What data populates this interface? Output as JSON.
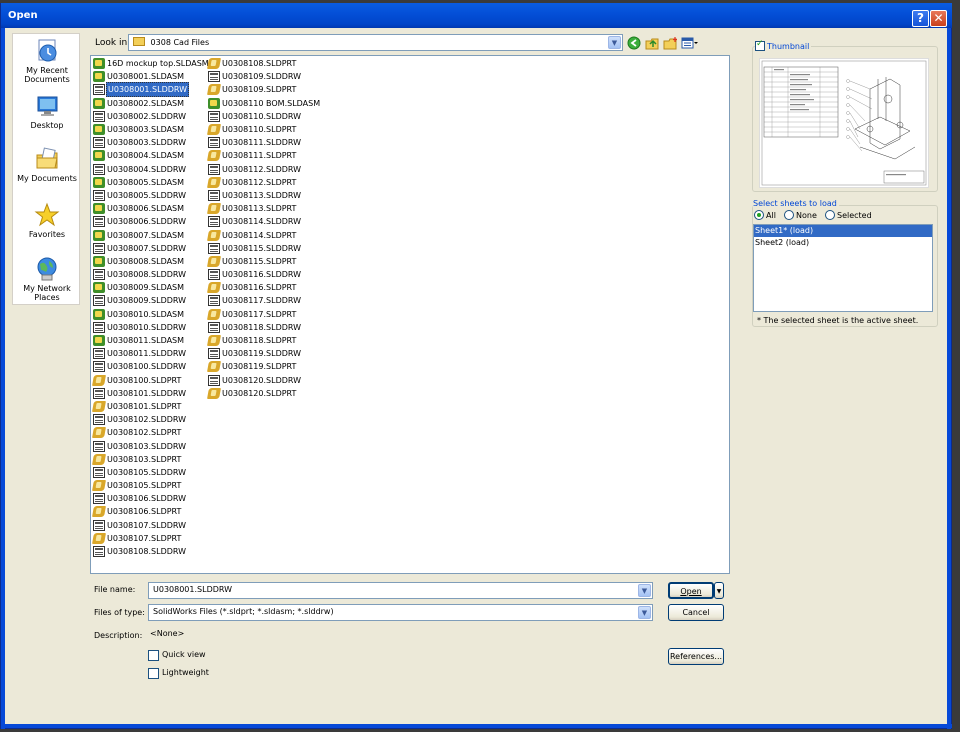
{
  "dialog": {
    "title": "Open",
    "help": "?",
    "close": "✕"
  },
  "places": [
    {
      "label": "My Recent Documents",
      "icon": "recent-documents-icon"
    },
    {
      "label": "Desktop",
      "icon": "desktop-icon"
    },
    {
      "label": "My Documents",
      "icon": "my-documents-icon"
    },
    {
      "label": "Favorites",
      "icon": "favorites-icon"
    },
    {
      "label": "My Network Places",
      "icon": "network-places-icon"
    }
  ],
  "lookin": {
    "label": "Look in:",
    "value": "0308 Cad Files"
  },
  "files_col1": [
    {
      "name": "16D mockup top.SLDASM",
      "t": "asm"
    },
    {
      "name": "U0308001.SLDASM",
      "t": "asm"
    },
    {
      "name": "U0308001.SLDDRW",
      "t": "drw",
      "sel": true
    },
    {
      "name": "U0308002.SLDASM",
      "t": "asm"
    },
    {
      "name": "U0308002.SLDDRW",
      "t": "drw"
    },
    {
      "name": "U0308003.SLDASM",
      "t": "asm"
    },
    {
      "name": "U0308003.SLDDRW",
      "t": "drw"
    },
    {
      "name": "U0308004.SLDASM",
      "t": "asm"
    },
    {
      "name": "U0308004.SLDDRW",
      "t": "drw"
    },
    {
      "name": "U0308005.SLDASM",
      "t": "asm"
    },
    {
      "name": "U0308005.SLDDRW",
      "t": "drw"
    },
    {
      "name": "U0308006.SLDASM",
      "t": "asm"
    },
    {
      "name": "U0308006.SLDDRW",
      "t": "drw"
    },
    {
      "name": "U0308007.SLDASM",
      "t": "asm"
    },
    {
      "name": "U0308007.SLDDRW",
      "t": "drw"
    },
    {
      "name": "U0308008.SLDASM",
      "t": "asm"
    },
    {
      "name": "U0308008.SLDDRW",
      "t": "drw"
    },
    {
      "name": "U0308009.SLDASM",
      "t": "asm"
    },
    {
      "name": "U0308009.SLDDRW",
      "t": "drw"
    },
    {
      "name": "U0308010.SLDASM",
      "t": "asm"
    },
    {
      "name": "U0308010.SLDDRW",
      "t": "drw"
    },
    {
      "name": "U0308011.SLDASM",
      "t": "asm"
    },
    {
      "name": "U0308011.SLDDRW",
      "t": "drw"
    },
    {
      "name": "U0308100.SLDDRW",
      "t": "drw"
    },
    {
      "name": "U0308100.SLDPRT",
      "t": "prt"
    },
    {
      "name": "U0308101.SLDDRW",
      "t": "drw"
    },
    {
      "name": "U0308101.SLDPRT",
      "t": "prt"
    },
    {
      "name": "U0308102.SLDDRW",
      "t": "drw"
    },
    {
      "name": "U0308102.SLDPRT",
      "t": "prt"
    },
    {
      "name": "U0308103.SLDDRW",
      "t": "drw"
    },
    {
      "name": "U0308103.SLDPRT",
      "t": "prt"
    },
    {
      "name": "U0308105.SLDDRW",
      "t": "drw"
    },
    {
      "name": "U0308105.SLDPRT",
      "t": "prt"
    },
    {
      "name": "U0308106.SLDDRW",
      "t": "drw"
    },
    {
      "name": "U0308106.SLDPRT",
      "t": "prt"
    },
    {
      "name": "U0308107.SLDDRW",
      "t": "drw"
    },
    {
      "name": "U0308107.SLDPRT",
      "t": "prt"
    },
    {
      "name": "U0308108.SLDDRW",
      "t": "drw"
    }
  ],
  "files_col2": [
    {
      "name": "U0308108.SLDPRT",
      "t": "prt"
    },
    {
      "name": "U0308109.SLDDRW",
      "t": "drw"
    },
    {
      "name": "U0308109.SLDPRT",
      "t": "prt"
    },
    {
      "name": "U0308110 BOM.SLDASM",
      "t": "asm"
    },
    {
      "name": "U0308110.SLDDRW",
      "t": "drw"
    },
    {
      "name": "U0308110.SLDPRT",
      "t": "prt"
    },
    {
      "name": "U0308111.SLDDRW",
      "t": "drw"
    },
    {
      "name": "U0308111.SLDPRT",
      "t": "prt"
    },
    {
      "name": "U0308112.SLDDRW",
      "t": "drw"
    },
    {
      "name": "U0308112.SLDPRT",
      "t": "prt"
    },
    {
      "name": "U0308113.SLDDRW",
      "t": "drw"
    },
    {
      "name": "U0308113.SLDPRT",
      "t": "prt"
    },
    {
      "name": "U0308114.SLDDRW",
      "t": "drw"
    },
    {
      "name": "U0308114.SLDPRT",
      "t": "prt"
    },
    {
      "name": "U0308115.SLDDRW",
      "t": "drw"
    },
    {
      "name": "U0308115.SLDPRT",
      "t": "prt"
    },
    {
      "name": "U0308116.SLDDRW",
      "t": "drw"
    },
    {
      "name": "U0308116.SLDPRT",
      "t": "prt"
    },
    {
      "name": "U0308117.SLDDRW",
      "t": "drw"
    },
    {
      "name": "U0308117.SLDPRT",
      "t": "prt"
    },
    {
      "name": "U0308118.SLDDRW",
      "t": "drw"
    },
    {
      "name": "U0308118.SLDPRT",
      "t": "prt"
    },
    {
      "name": "U0308119.SLDDRW",
      "t": "drw"
    },
    {
      "name": "U0308119.SLDPRT",
      "t": "prt"
    },
    {
      "name": "U0308120.SLDDRW",
      "t": "drw"
    },
    {
      "name": "U0308120.SLDPRT",
      "t": "prt"
    }
  ],
  "filename": {
    "label": "File name:",
    "value": "U0308001.SLDDRW"
  },
  "filetype": {
    "label": "Files of type:",
    "value": "SolidWorks Files (*.sldprt; *.sldasm; *.slddrw)"
  },
  "description": {
    "label": "Description:",
    "value": "<None>"
  },
  "buttons": {
    "open": "Open",
    "cancel": "Cancel",
    "references": "References..."
  },
  "options": {
    "quick_view": "Quick view",
    "lightweight": "Lightweight"
  },
  "thumbnail": {
    "label": "Thumbnail",
    "checked": true
  },
  "sheets": {
    "title": "Select sheets to load",
    "radios": {
      "all": "All",
      "none": "None",
      "selected": "Selected"
    },
    "items": [
      "Sheet1* (load)",
      "Sheet2 (load)"
    ],
    "note": "* The selected sheet is the active sheet."
  }
}
